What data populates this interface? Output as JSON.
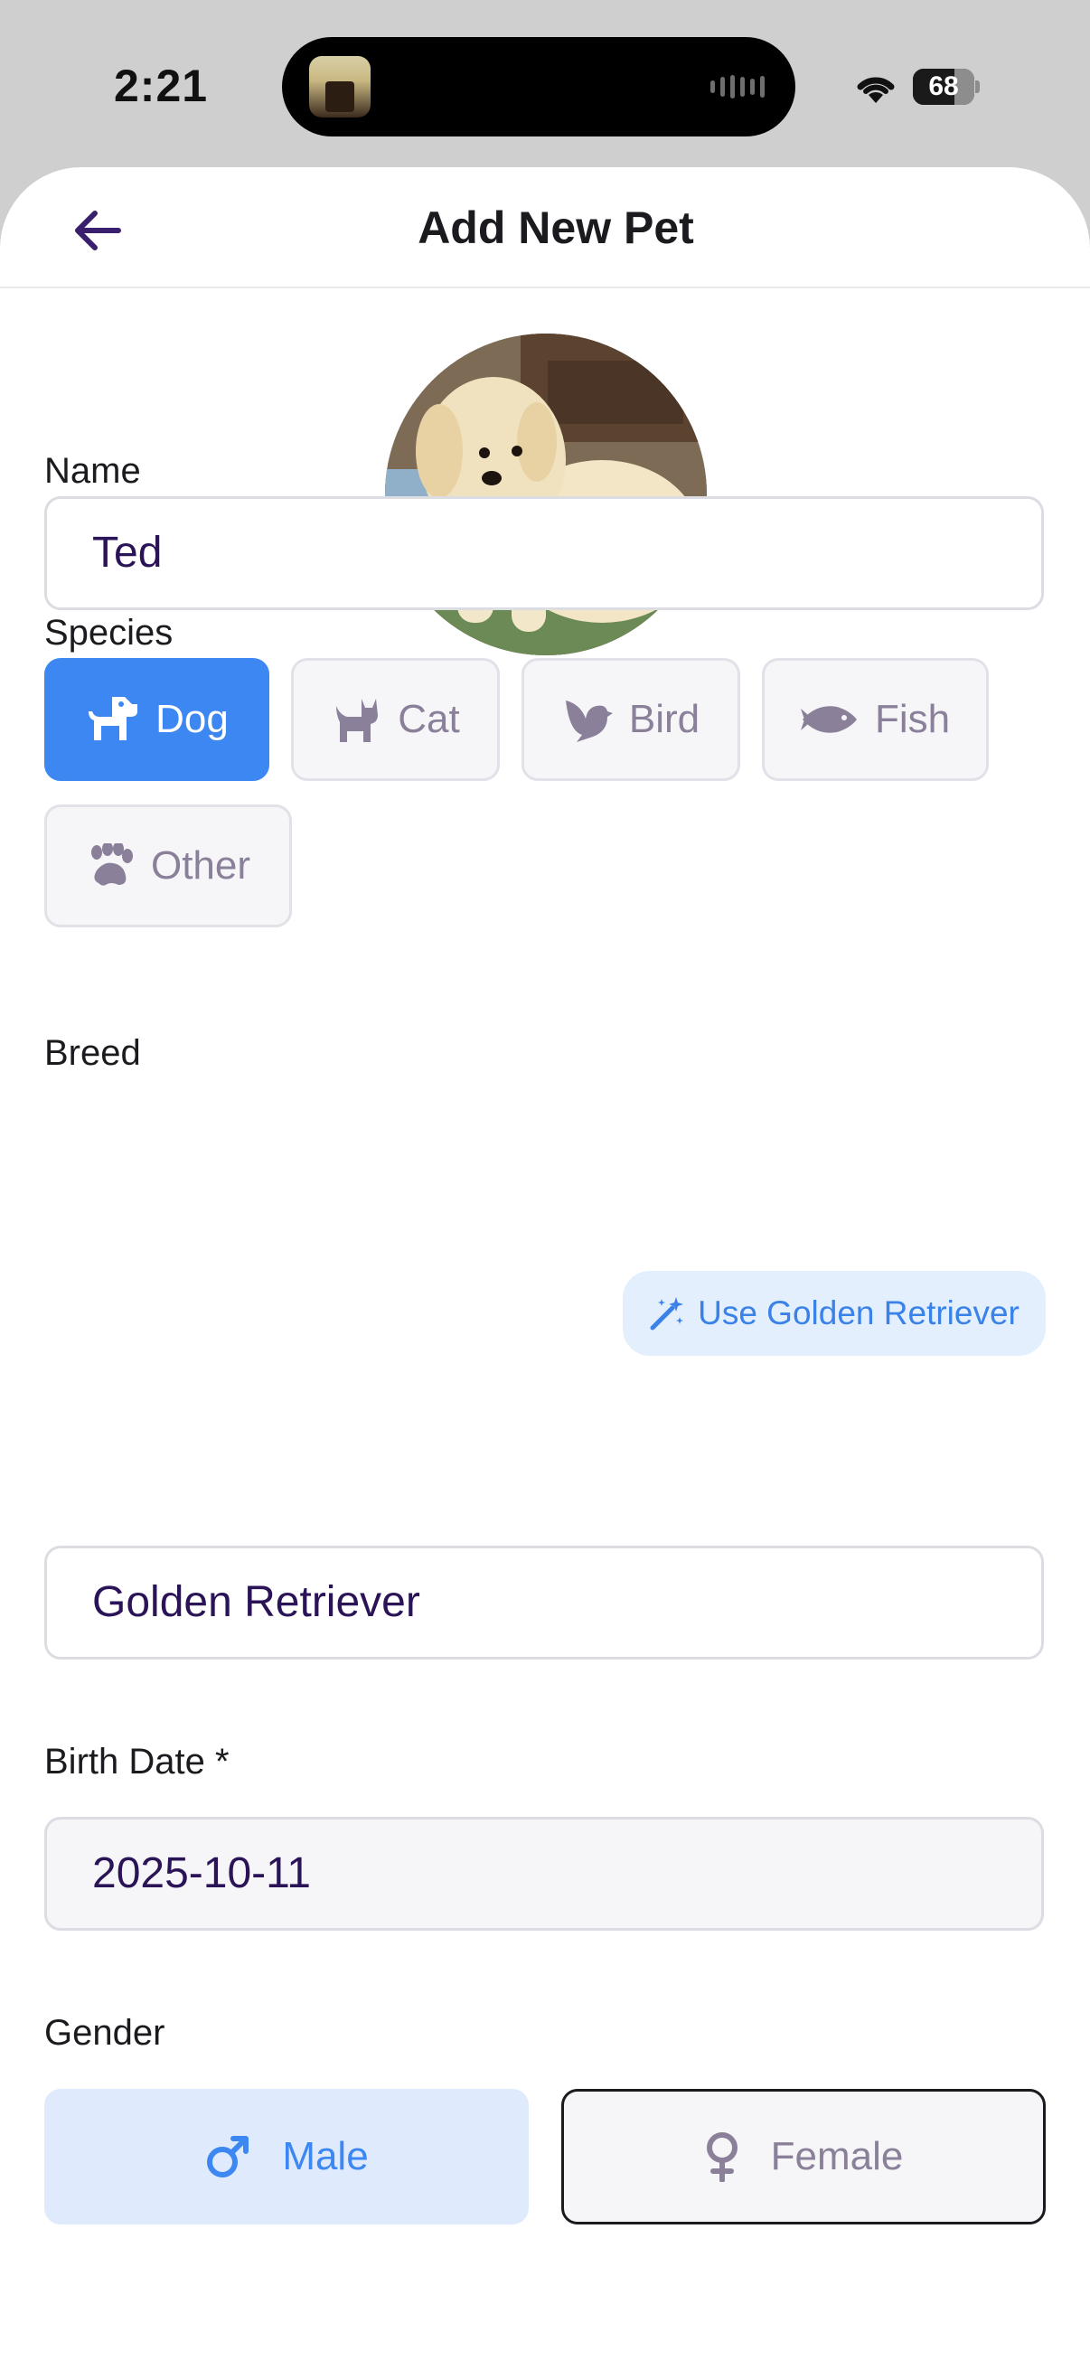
{
  "status_bar": {
    "time": "2:21",
    "battery": "68",
    "battery_level": 0.68
  },
  "header": {
    "title": "Add New Pet"
  },
  "name": {
    "label": "Name",
    "value": "Ted"
  },
  "species": {
    "label": "Species",
    "options": [
      {
        "label": "Dog",
        "icon": "dog-icon",
        "selected": true
      },
      {
        "label": "Cat",
        "icon": "cat-icon",
        "selected": false
      },
      {
        "label": "Bird",
        "icon": "bird-icon",
        "selected": false
      },
      {
        "label": "Fish",
        "icon": "fish-icon",
        "selected": false
      },
      {
        "label": "Other",
        "icon": "paw-icon",
        "selected": false
      }
    ]
  },
  "breed": {
    "label": "Breed",
    "suggest_button": "Use Golden Retriever",
    "value": "Golden Retriever"
  },
  "birth_date": {
    "label": "Birth Date *",
    "value": "2025-10-11"
  },
  "gender": {
    "label": "Gender",
    "male": "Male",
    "female": "Female",
    "selected": "Male"
  },
  "colors": {
    "accent": "#3c87f2",
    "accent_light": "#dfebfd",
    "value_text": "#2a1457",
    "muted": "#8a8099"
  }
}
